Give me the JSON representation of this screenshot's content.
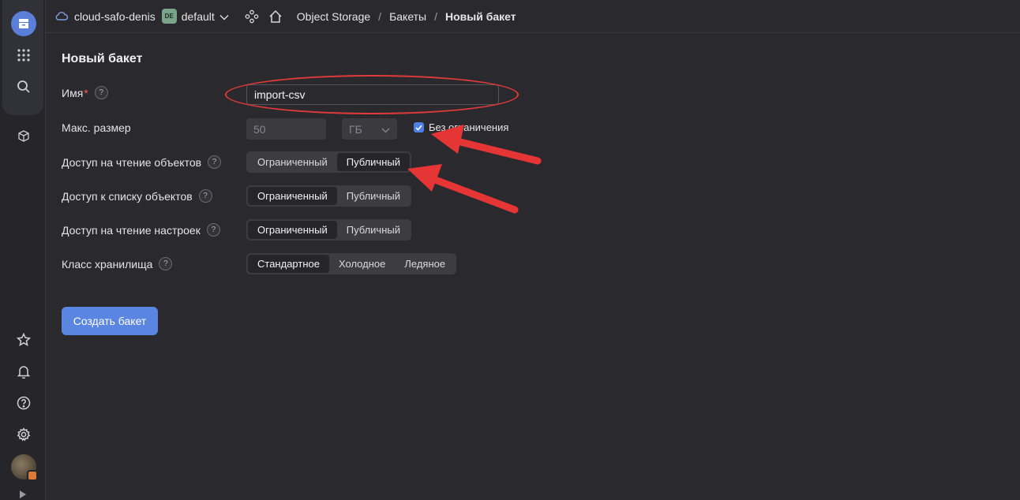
{
  "header": {
    "cloud_name": "cloud-safo-denis",
    "folder_badge": "DE",
    "folder_name": "default",
    "breadcrumbs": [
      "Object Storage",
      "Бакеты",
      "Новый бакет"
    ],
    "separator": "/"
  },
  "form": {
    "title": "Новый бакет",
    "name": {
      "label": "Имя",
      "required_mark": "*",
      "value": "import-csv"
    },
    "max_size": {
      "label": "Макс. размер",
      "value": "50",
      "unit": "ГБ",
      "unlimited_label": "Без ограничения",
      "unlimited_checked": true
    },
    "read_objects": {
      "label": "Доступ на чтение объектов",
      "options": [
        "Ограниченный",
        "Публичный"
      ],
      "selected": "Публичный"
    },
    "list_objects": {
      "label": "Доступ к списку объектов",
      "options": [
        "Ограниченный",
        "Публичный"
      ],
      "selected": "Ограниченный"
    },
    "read_settings": {
      "label": "Доступ на чтение настроек",
      "options": [
        "Ограниченный",
        "Публичный"
      ],
      "selected": "Ограниченный"
    },
    "storage_class": {
      "label": "Класс хранилища",
      "options": [
        "Стандартное",
        "Холодное",
        "Ледяное"
      ],
      "selected": "Стандартное"
    },
    "help_glyph": "?",
    "submit_label": "Создать бакет"
  },
  "rail": {
    "icons": [
      "storage-icon",
      "apps-grid-icon",
      "search-icon",
      "box-icon",
      "star-icon",
      "bell-icon",
      "help-icon",
      "gear-icon",
      "avatar"
    ]
  },
  "colors": {
    "accent": "#5a85e0",
    "annotation": "#e03a3a",
    "background": "#2a2a2e"
  }
}
